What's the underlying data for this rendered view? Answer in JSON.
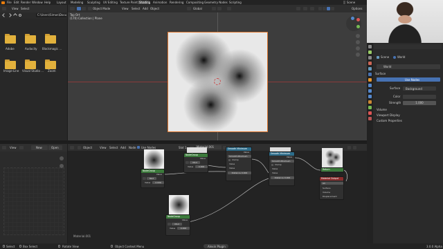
{
  "menubar": {
    "items": [
      "File",
      "Edit",
      "Render",
      "Window",
      "Help"
    ],
    "workspaces": [
      "Layout",
      "Modeling",
      "Sculpting",
      "UV Editing",
      "Texture Paint",
      "Shading",
      "Animation",
      "Rendering",
      "Compositing",
      "Geometry Nodes",
      "Scripting"
    ],
    "active_workspace": "Shading",
    "scene": "Scene"
  },
  "filebrowser": {
    "menu": [
      "View",
      "Select"
    ],
    "path": "C:\\Users\\Simon\\Docum...",
    "folders": [
      "Adobe",
      "Audacity",
      "Blackmagic ...",
      "Image-Line",
      "Visual Studio ...",
      "Zoom"
    ]
  },
  "viewport": {
    "mode": "Object Mode",
    "menu": [
      "View",
      "Select",
      "Add",
      "Object"
    ],
    "orientation": "Global",
    "options": "Options",
    "info_line1": "Top Ort",
    "info_line2": "(170) Collection | Plane"
  },
  "image_editor": {
    "menu": [
      "View",
      "+",
      "New",
      "Open"
    ]
  },
  "node_editor": {
    "type": "Object",
    "menu": [
      "View",
      "Select",
      "Add",
      "Node"
    ],
    "use_nodes": "Use Nodes",
    "slot": "Slot 1",
    "material": "Material.001",
    "footer_label": "Material.001",
    "nodes": {
      "ng1": {
        "title": "NodeGroup",
        "out": "Value",
        "tag": "Mod",
        "field_label": "Value",
        "field_value": "2.939"
      },
      "ng2": {
        "title": "NodeGroup",
        "out": "Value",
        "tag": "Mod",
        "field_label": "Value",
        "field_value": "4.000"
      },
      "ng3": {
        "title": "NodeGroup",
        "out": "Value",
        "tag": "Mod",
        "field_label": "Value",
        "field_value": "4.000"
      },
      "sm1": {
        "title": "Smooth Minimum",
        "out": "Value",
        "dropdown": "Smooth Minimum",
        "clamp": "Clamp",
        "in1": "Value",
        "in2": "Value",
        "dist_label": "Distance",
        "dist_value": "0.000"
      },
      "sm2": {
        "title": "Smooth Minimum",
        "out": "Value",
        "dropdown": "Smooth Minimum",
        "clamp": "Clamp",
        "in1": "Value",
        "in2": "Value",
        "dist_label": "Distance",
        "dist_value": "0.000"
      },
      "ret": {
        "title": "Return",
        "out": "Return"
      },
      "mo": {
        "title": "Material Output",
        "target": "All",
        "in1": "Surface",
        "in2": "Volume",
        "in3": "Displacement"
      }
    }
  },
  "properties": {
    "breadcrumb_scene": "Scene",
    "breadcrumb_world": "World",
    "world_name": "World",
    "surface_panel": "Surface",
    "use_nodes": "Use Nodes",
    "surface_label": "Surface",
    "surface_value": "Background",
    "color_label": "Color",
    "strength_label": "Strength",
    "strength_value": "1.000",
    "panels": [
      "Volume",
      "Viewport Display",
      "Custom Properties"
    ]
  },
  "statusbar": {
    "select": "Select",
    "box_select": "Box Select",
    "rotate": "Rotate View",
    "context_menu": "Object Context Menu",
    "badge": "Alexin Plugin",
    "version": "3.0.0 Alpha"
  },
  "colors": {
    "accent_blue": "#4772b3",
    "active_tab": "#4b4b4b",
    "folder": "#e2b13c",
    "node_group_header": "#3b7a3b",
    "smooth_min_header": "#2c6c8a",
    "output_header": "#8a2c2c",
    "selection_outline": "#e07830"
  }
}
